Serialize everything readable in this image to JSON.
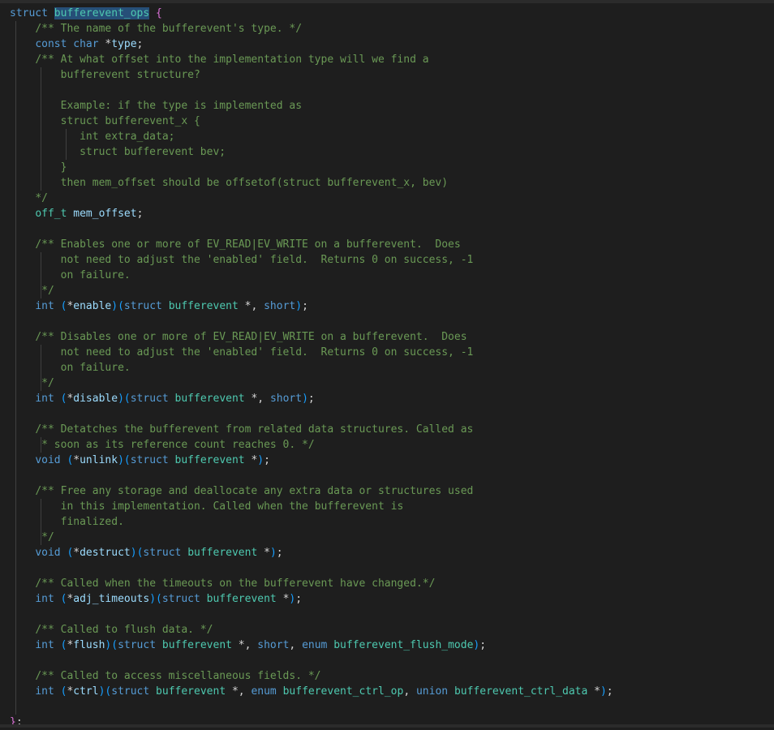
{
  "editor": {
    "lines": [
      [
        [
          "kw",
          "struct "
        ],
        [
          "hl",
          "bufferevent_ops"
        ],
        [
          "pu",
          " "
        ],
        [
          "br1",
          "{"
        ]
      ],
      [
        [
          "pu",
          "    "
        ],
        [
          "cm",
          "/** The name of the bufferevent's type. */"
        ]
      ],
      [
        [
          "pu",
          "    "
        ],
        [
          "kw",
          "const char "
        ],
        [
          "pu",
          "*"
        ],
        [
          "id",
          "type"
        ],
        [
          "pu",
          ";"
        ]
      ],
      [
        [
          "pu",
          "    "
        ],
        [
          "cm",
          "/** At what offset into the implementation type will we find a"
        ]
      ],
      [
        [
          "pu",
          "        "
        ],
        [
          "cm",
          "bufferevent structure?"
        ]
      ],
      [
        [
          "pu",
          ""
        ]
      ],
      [
        [
          "pu",
          "        "
        ],
        [
          "cm",
          "Example: if the type is implemented as"
        ]
      ],
      [
        [
          "pu",
          "        "
        ],
        [
          "cm",
          "struct bufferevent_x {"
        ]
      ],
      [
        [
          "pu",
          "           "
        ],
        [
          "cm",
          "int extra_data;"
        ]
      ],
      [
        [
          "pu",
          "           "
        ],
        [
          "cm",
          "struct bufferevent bev;"
        ]
      ],
      [
        [
          "pu",
          "        "
        ],
        [
          "cm",
          "}"
        ]
      ],
      [
        [
          "pu",
          "        "
        ],
        [
          "cm",
          "then mem_offset should be offsetof(struct bufferevent_x, bev)"
        ]
      ],
      [
        [
          "pu",
          "    "
        ],
        [
          "cm",
          "*/"
        ]
      ],
      [
        [
          "pu",
          "    "
        ],
        [
          "ty",
          "off_t "
        ],
        [
          "id",
          "mem_offset"
        ],
        [
          "pu",
          ";"
        ]
      ],
      [
        [
          "pu",
          ""
        ]
      ],
      [
        [
          "pu",
          "    "
        ],
        [
          "cm",
          "/** Enables one or more of EV_READ|EV_WRITE on a bufferevent.  Does"
        ]
      ],
      [
        [
          "pu",
          "        "
        ],
        [
          "cm",
          "not need to adjust the 'enabled' field.  Returns 0 on success, -1"
        ]
      ],
      [
        [
          "pu",
          "        "
        ],
        [
          "cm",
          "on failure."
        ]
      ],
      [
        [
          "pu",
          "     "
        ],
        [
          "cm",
          "*/"
        ]
      ],
      [
        [
          "pu",
          "    "
        ],
        [
          "kw",
          "int "
        ],
        [
          "br2",
          "("
        ],
        [
          "pu",
          "*"
        ],
        [
          "id",
          "enable"
        ],
        [
          "br2",
          ")"
        ],
        [
          "br2",
          "("
        ],
        [
          "kw",
          "struct "
        ],
        [
          "ty",
          "bufferevent "
        ],
        [
          "pu",
          "*, "
        ],
        [
          "kw",
          "short"
        ],
        [
          "br2",
          ")"
        ],
        [
          "pu",
          ";"
        ]
      ],
      [
        [
          "pu",
          ""
        ]
      ],
      [
        [
          "pu",
          "    "
        ],
        [
          "cm",
          "/** Disables one or more of EV_READ|EV_WRITE on a bufferevent.  Does"
        ]
      ],
      [
        [
          "pu",
          "        "
        ],
        [
          "cm",
          "not need to adjust the 'enabled' field.  Returns 0 on success, -1"
        ]
      ],
      [
        [
          "pu",
          "        "
        ],
        [
          "cm",
          "on failure."
        ]
      ],
      [
        [
          "pu",
          "     "
        ],
        [
          "cm",
          "*/"
        ]
      ],
      [
        [
          "pu",
          "    "
        ],
        [
          "kw",
          "int "
        ],
        [
          "br2",
          "("
        ],
        [
          "pu",
          "*"
        ],
        [
          "id",
          "disable"
        ],
        [
          "br2",
          ")"
        ],
        [
          "br2",
          "("
        ],
        [
          "kw",
          "struct "
        ],
        [
          "ty",
          "bufferevent "
        ],
        [
          "pu",
          "*, "
        ],
        [
          "kw",
          "short"
        ],
        [
          "br2",
          ")"
        ],
        [
          "pu",
          ";"
        ]
      ],
      [
        [
          "pu",
          ""
        ]
      ],
      [
        [
          "pu",
          "    "
        ],
        [
          "cm",
          "/** Detatches the bufferevent from related data structures. Called as"
        ]
      ],
      [
        [
          "pu",
          "     "
        ],
        [
          "cm",
          "* soon as its reference count reaches 0. */"
        ]
      ],
      [
        [
          "pu",
          "    "
        ],
        [
          "kw",
          "void "
        ],
        [
          "br2",
          "("
        ],
        [
          "pu",
          "*"
        ],
        [
          "id",
          "unlink"
        ],
        [
          "br2",
          ")"
        ],
        [
          "br2",
          "("
        ],
        [
          "kw",
          "struct "
        ],
        [
          "ty",
          "bufferevent "
        ],
        [
          "pu",
          "*"
        ],
        [
          "br2",
          ")"
        ],
        [
          "pu",
          ";"
        ]
      ],
      [
        [
          "pu",
          ""
        ]
      ],
      [
        [
          "pu",
          "    "
        ],
        [
          "cm",
          "/** Free any storage and deallocate any extra data or structures used"
        ]
      ],
      [
        [
          "pu",
          "        "
        ],
        [
          "cm",
          "in this implementation. Called when the bufferevent is"
        ]
      ],
      [
        [
          "pu",
          "        "
        ],
        [
          "cm",
          "finalized."
        ]
      ],
      [
        [
          "pu",
          "     "
        ],
        [
          "cm",
          "*/"
        ]
      ],
      [
        [
          "pu",
          "    "
        ],
        [
          "kw",
          "void "
        ],
        [
          "br2",
          "("
        ],
        [
          "pu",
          "*"
        ],
        [
          "id",
          "destruct"
        ],
        [
          "br2",
          ")"
        ],
        [
          "br2",
          "("
        ],
        [
          "kw",
          "struct "
        ],
        [
          "ty",
          "bufferevent "
        ],
        [
          "pu",
          "*"
        ],
        [
          "br2",
          ")"
        ],
        [
          "pu",
          ";"
        ]
      ],
      [
        [
          "pu",
          ""
        ]
      ],
      [
        [
          "pu",
          "    "
        ],
        [
          "cm",
          "/** Called when the timeouts on the bufferevent have changed.*/"
        ]
      ],
      [
        [
          "pu",
          "    "
        ],
        [
          "kw",
          "int "
        ],
        [
          "br2",
          "("
        ],
        [
          "pu",
          "*"
        ],
        [
          "id",
          "adj_timeouts"
        ],
        [
          "br2",
          ")"
        ],
        [
          "br2",
          "("
        ],
        [
          "kw",
          "struct "
        ],
        [
          "ty",
          "bufferevent "
        ],
        [
          "pu",
          "*"
        ],
        [
          "br2",
          ")"
        ],
        [
          "pu",
          ";"
        ]
      ],
      [
        [
          "pu",
          ""
        ]
      ],
      [
        [
          "pu",
          "    "
        ],
        [
          "cm",
          "/** Called to flush data. */"
        ]
      ],
      [
        [
          "pu",
          "    "
        ],
        [
          "kw",
          "int "
        ],
        [
          "br2",
          "("
        ],
        [
          "pu",
          "*"
        ],
        [
          "id",
          "flush"
        ],
        [
          "br2",
          ")"
        ],
        [
          "br2",
          "("
        ],
        [
          "kw",
          "struct "
        ],
        [
          "ty",
          "bufferevent "
        ],
        [
          "pu",
          "*, "
        ],
        [
          "kw",
          "short"
        ],
        [
          "pu",
          ", "
        ],
        [
          "kw",
          "enum "
        ],
        [
          "ty",
          "bufferevent_flush_mode"
        ],
        [
          "br2",
          ")"
        ],
        [
          "pu",
          ";"
        ]
      ],
      [
        [
          "pu",
          ""
        ]
      ],
      [
        [
          "pu",
          "    "
        ],
        [
          "cm",
          "/** Called to access miscellaneous fields. */"
        ]
      ],
      [
        [
          "pu",
          "    "
        ],
        [
          "kw",
          "int "
        ],
        [
          "br2",
          "("
        ],
        [
          "pu",
          "*"
        ],
        [
          "id",
          "ctrl"
        ],
        [
          "br2",
          ")"
        ],
        [
          "br2",
          "("
        ],
        [
          "kw",
          "struct "
        ],
        [
          "ty",
          "bufferevent "
        ],
        [
          "pu",
          "*, "
        ],
        [
          "kw",
          "enum "
        ],
        [
          "ty",
          "bufferevent_ctrl_op"
        ],
        [
          "pu",
          ", "
        ],
        [
          "kw",
          "union "
        ],
        [
          "ty",
          "bufferevent_ctrl_data "
        ],
        [
          "pu",
          "*"
        ],
        [
          "br2",
          ")"
        ],
        [
          "pu",
          ";"
        ]
      ],
      [
        [
          "pu",
          ""
        ]
      ],
      [
        [
          "br1",
          "}"
        ],
        [
          "pu",
          ";"
        ]
      ]
    ]
  }
}
